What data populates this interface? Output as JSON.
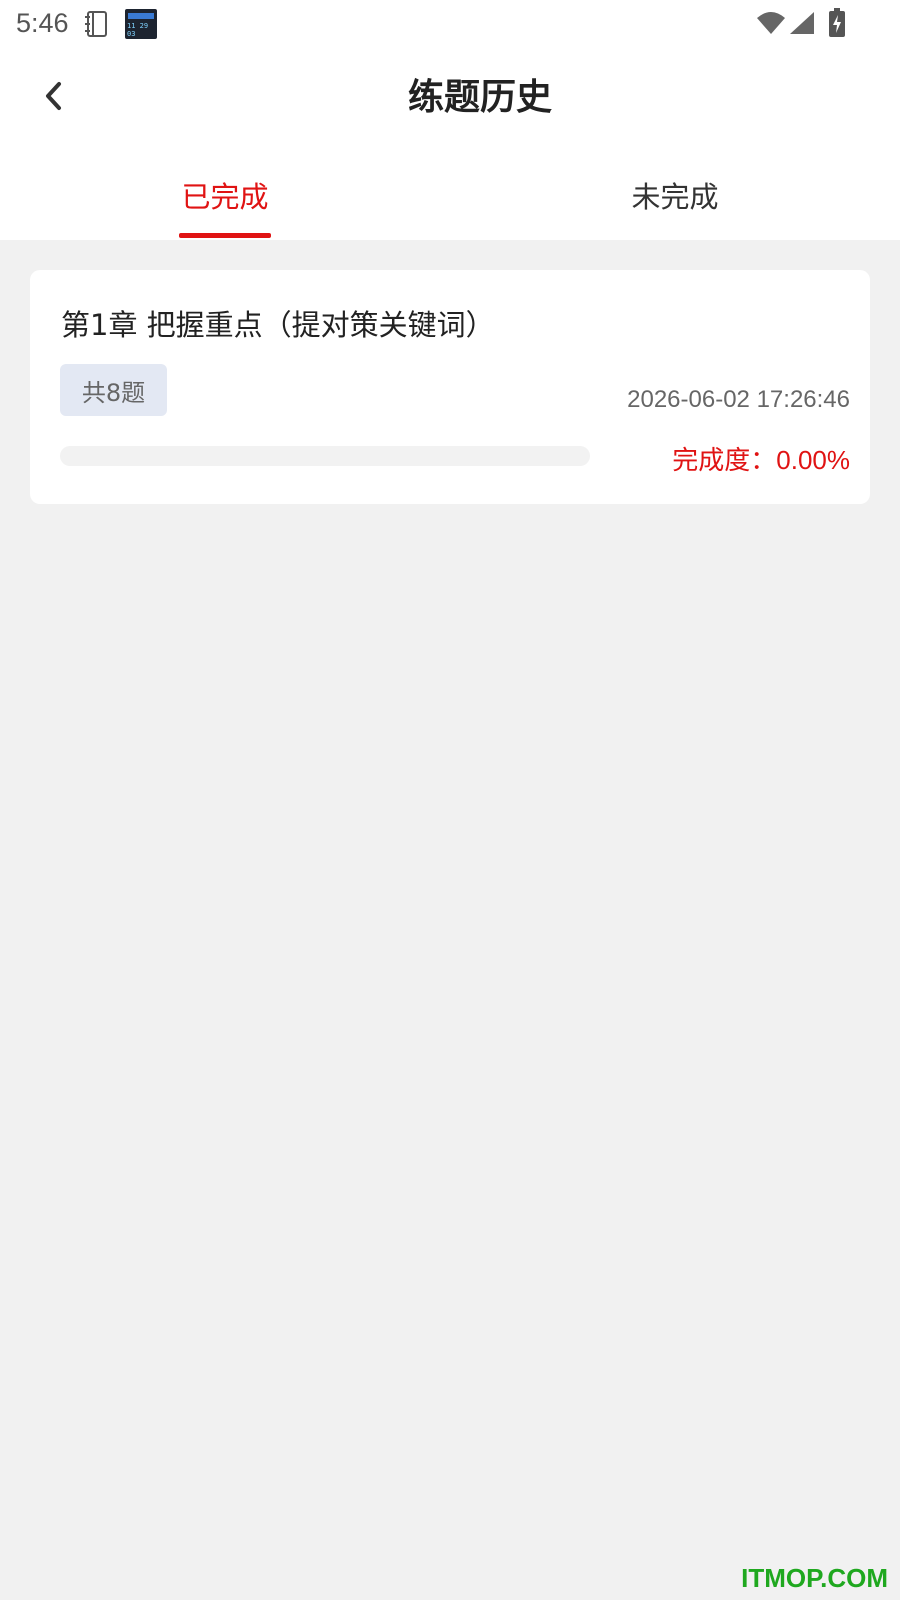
{
  "status_bar": {
    "time": "5:46",
    "thumb_digits": "11 29 03",
    "icons": [
      "notebook-icon",
      "app-thumbnail-icon",
      "wifi-icon",
      "signal-icon",
      "battery-charging-icon"
    ]
  },
  "header": {
    "title": "练题历史",
    "back_icon": "chevron-left-icon"
  },
  "tabs": [
    {
      "label": "已完成",
      "active": true
    },
    {
      "label": "未完成",
      "active": false
    }
  ],
  "records": [
    {
      "title": "第1章 把握重点（提对策关键词）",
      "count_label": "共8题",
      "date": "2026-06-02 17:26:46",
      "completion_label": "完成度：",
      "completion_value": "0.00%",
      "progress": 0.0
    }
  ],
  "colors": {
    "accent": "#e01313",
    "background": "#f1f1f1",
    "badge_bg": "#e3e8f3",
    "watermark": "#1fa81f"
  },
  "watermark": "ITMOP.COM"
}
